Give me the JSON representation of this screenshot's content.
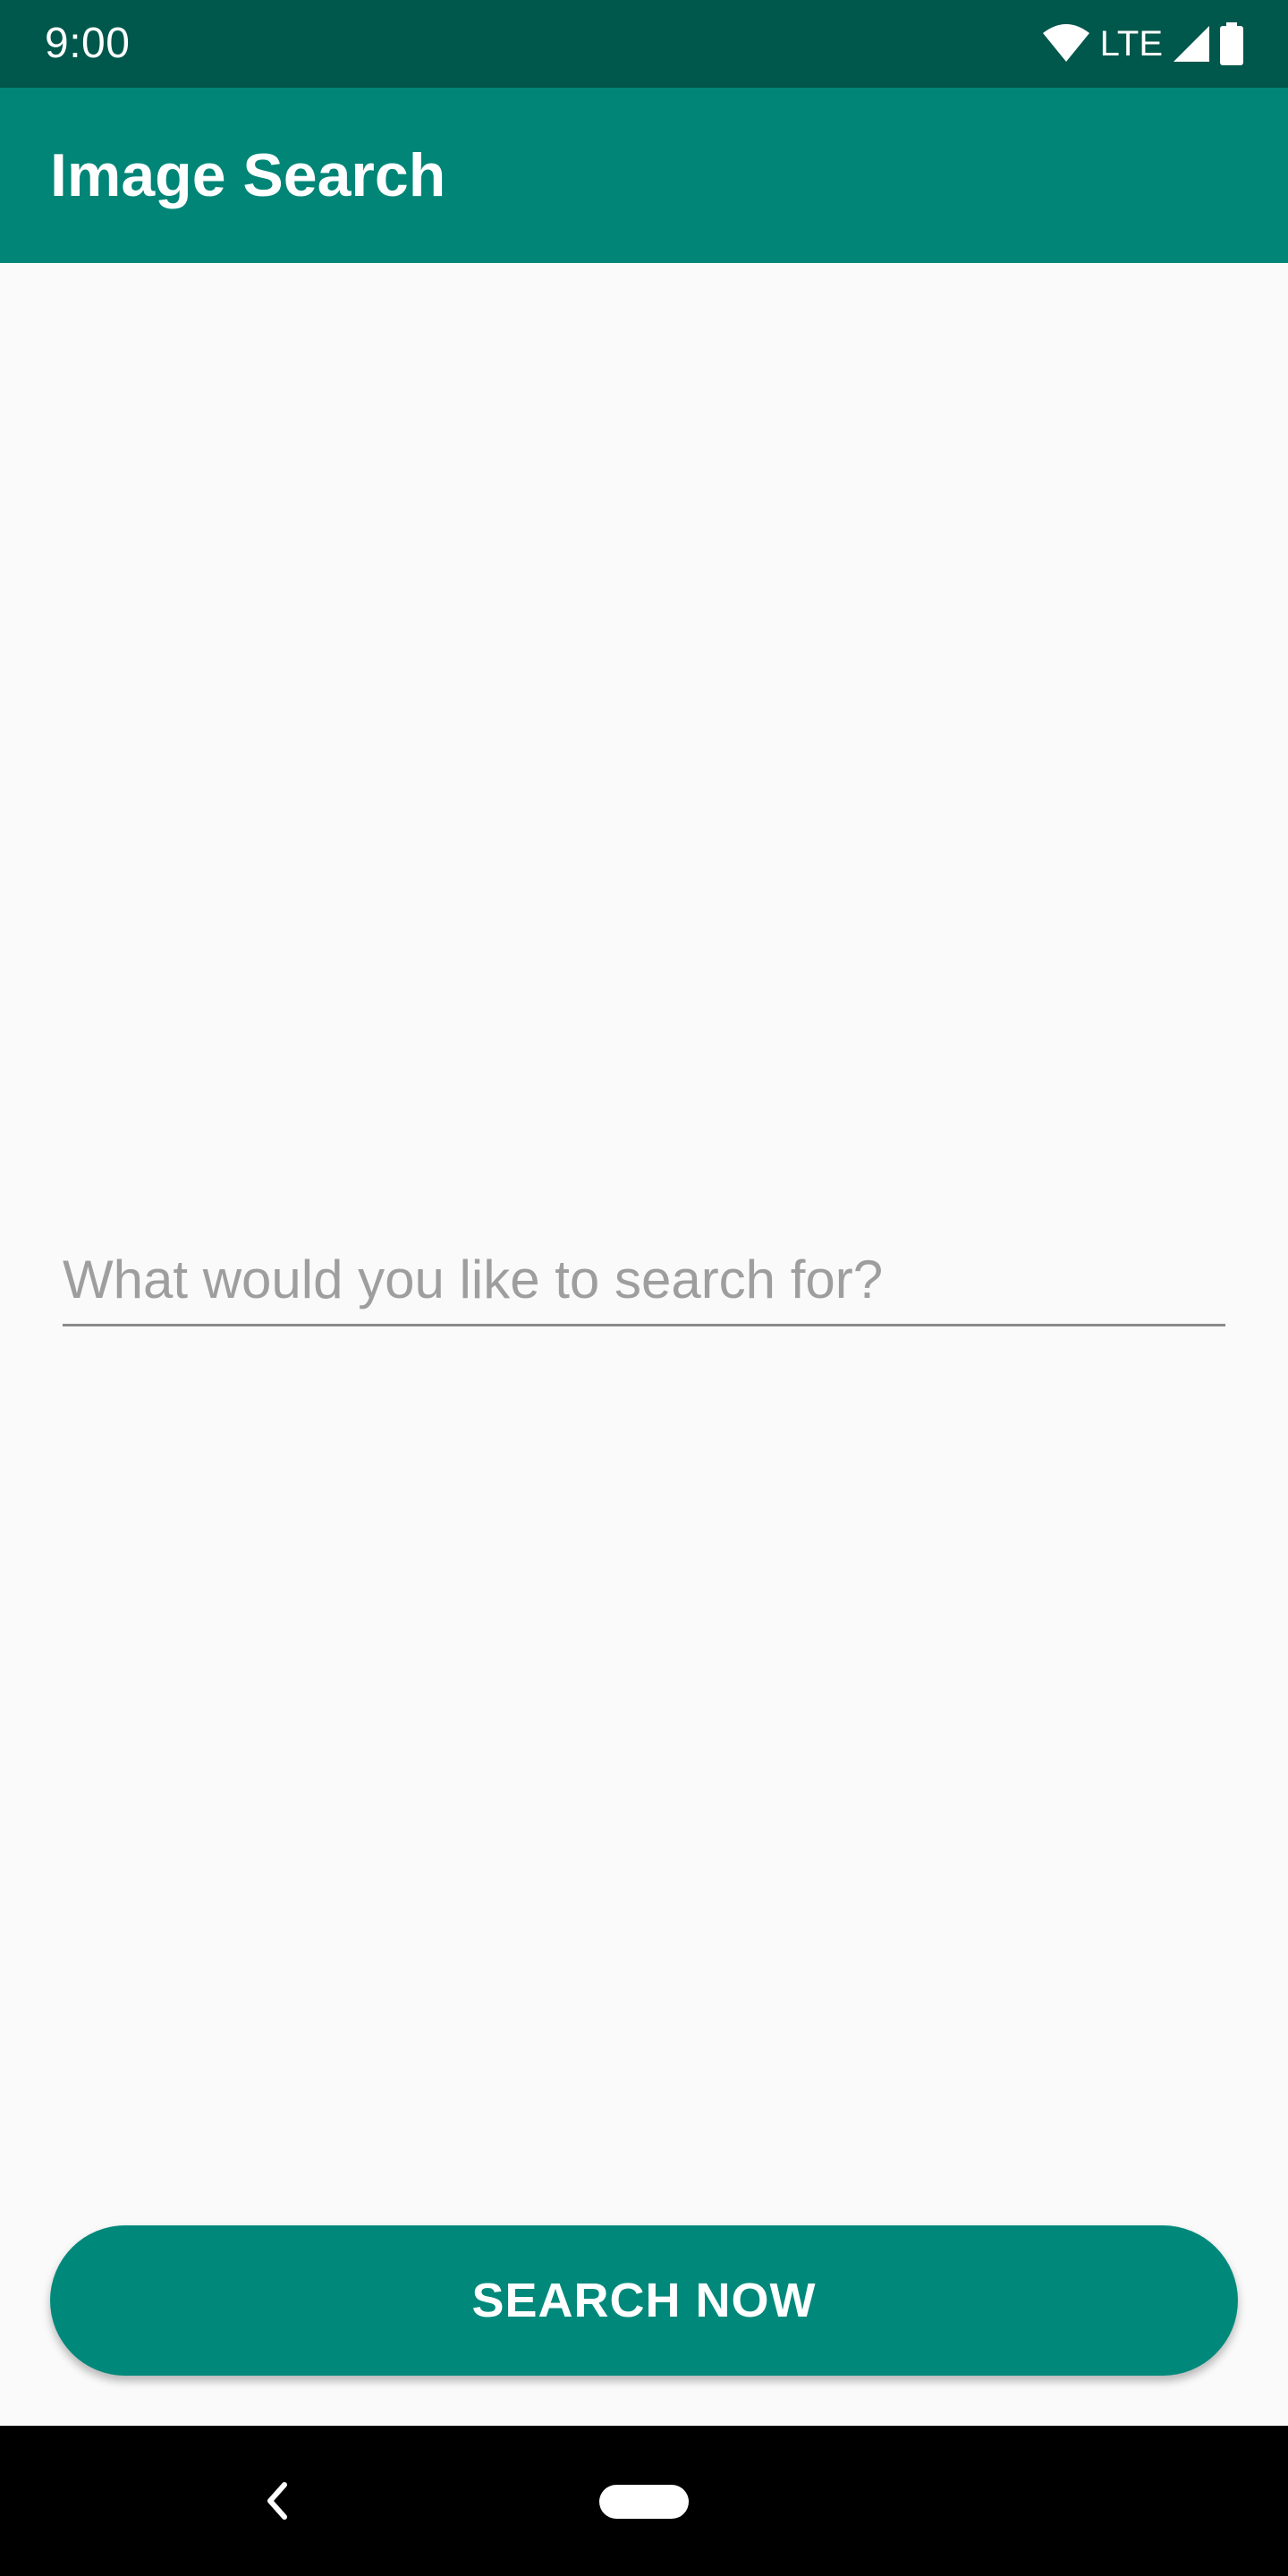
{
  "status_bar": {
    "time": "9:00",
    "network_label": "LTE",
    "icons": [
      "wifi-icon",
      "signal-icon",
      "battery-icon"
    ]
  },
  "app_bar": {
    "title": "Image Search"
  },
  "search": {
    "placeholder": "What would you like to search for?",
    "value": ""
  },
  "actions": {
    "search_button_label": "SEARCH NOW"
  },
  "nav_bar": {
    "icons": [
      "back-icon",
      "home-pill-icon"
    ]
  },
  "colors": {
    "status_bar": "#00574b",
    "app_bar": "#008577",
    "accent": "#00897b",
    "background": "#fafafa"
  }
}
